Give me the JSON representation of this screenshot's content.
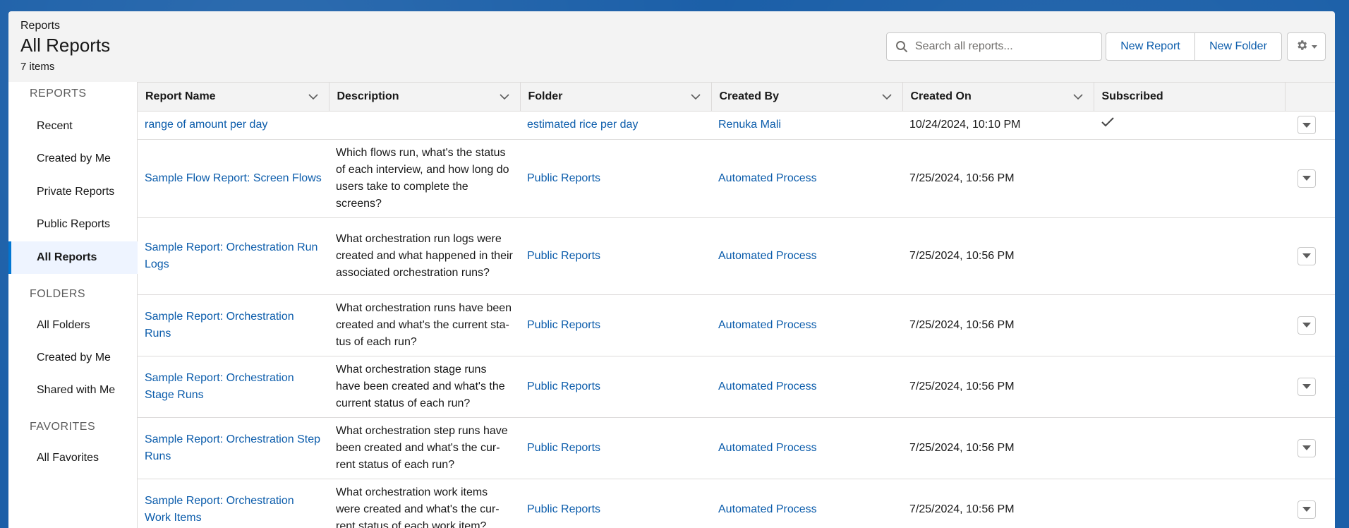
{
  "header": {
    "breadcrumb": "Reports",
    "title": "All Reports",
    "item_count": "7 items"
  },
  "search": {
    "placeholder": "Search all reports..."
  },
  "buttons": {
    "new_report": "New Report",
    "new_folder": "New Folder",
    "settings_icon": "gear-icon"
  },
  "sidebar": {
    "sections": [
      {
        "label": "REPORTS",
        "items": [
          "Recent",
          "Created by Me",
          "Private Reports",
          "Public Reports",
          "All Reports"
        ]
      },
      {
        "label": "FOLDERS",
        "items": [
          "All Folders",
          "Created by Me",
          "Shared with Me"
        ]
      },
      {
        "label": "FAVORITES",
        "items": [
          "All Favorites"
        ]
      }
    ],
    "active": "All Reports"
  },
  "table": {
    "columns": [
      "Report Name",
      "Description",
      "Folder",
      "Created By",
      "Created On",
      "Subscribed"
    ],
    "rows": [
      {
        "name": "range of amount per day",
        "description": "",
        "folder": "estimated rice per day",
        "created_by": "Renuka Mali",
        "created_on": "10/24/2024, 10:10 PM",
        "subscribed": true
      },
      {
        "name": "Sample Flow Report: Screen Flows",
        "description": "Which flows run, what's the status of each interview, and how long do users take to complete the screens?",
        "folder": "Public Reports",
        "created_by": "Automated Process",
        "created_on": "7/25/2024, 10:56 PM",
        "subscribed": false
      },
      {
        "name": "Sample Report: Orchestration Run Logs",
        "description": "What orchestration run logs were created and what happened in their associated orchestration runs?",
        "folder": "Public Reports",
        "created_by": "Automated Process",
        "created_on": "7/25/2024, 10:56 PM",
        "subscribed": false
      },
      {
        "name": "Sample Report: Orchestration Runs",
        "description": "What orchestration runs have been created and what's the current sta-tus of each run?",
        "folder": "Public Reports",
        "created_by": "Automated Process",
        "created_on": "7/25/2024, 10:56 PM",
        "subscribed": false
      },
      {
        "name": "Sample Report: Orchestration Stage Runs",
        "description": "What orchestration stage runs have been created and what's the current status of each run?",
        "folder": "Public Reports",
        "created_by": "Automated Process",
        "created_on": "7/25/2024, 10:56 PM",
        "subscribed": false
      },
      {
        "name": "Sample Report: Orchestration Step Runs",
        "description": "What orchestration step runs have been created and what's the cur-rent status of each run?",
        "folder": "Public Reports",
        "created_by": "Automated Process",
        "created_on": "7/25/2024, 10:56 PM",
        "subscribed": false
      },
      {
        "name": "Sample Report: Orchestration Work Items",
        "description": "What orchestration work items were created and what's the cur-rent status of each work item?",
        "folder": "Public Reports",
        "created_by": "Automated Process",
        "created_on": "7/25/2024, 10:56 PM",
        "subscribed": false
      }
    ]
  },
  "colors": {
    "link": "#0b5cab",
    "accent": "#0176d3",
    "page_bg": "#1b5fa8"
  }
}
